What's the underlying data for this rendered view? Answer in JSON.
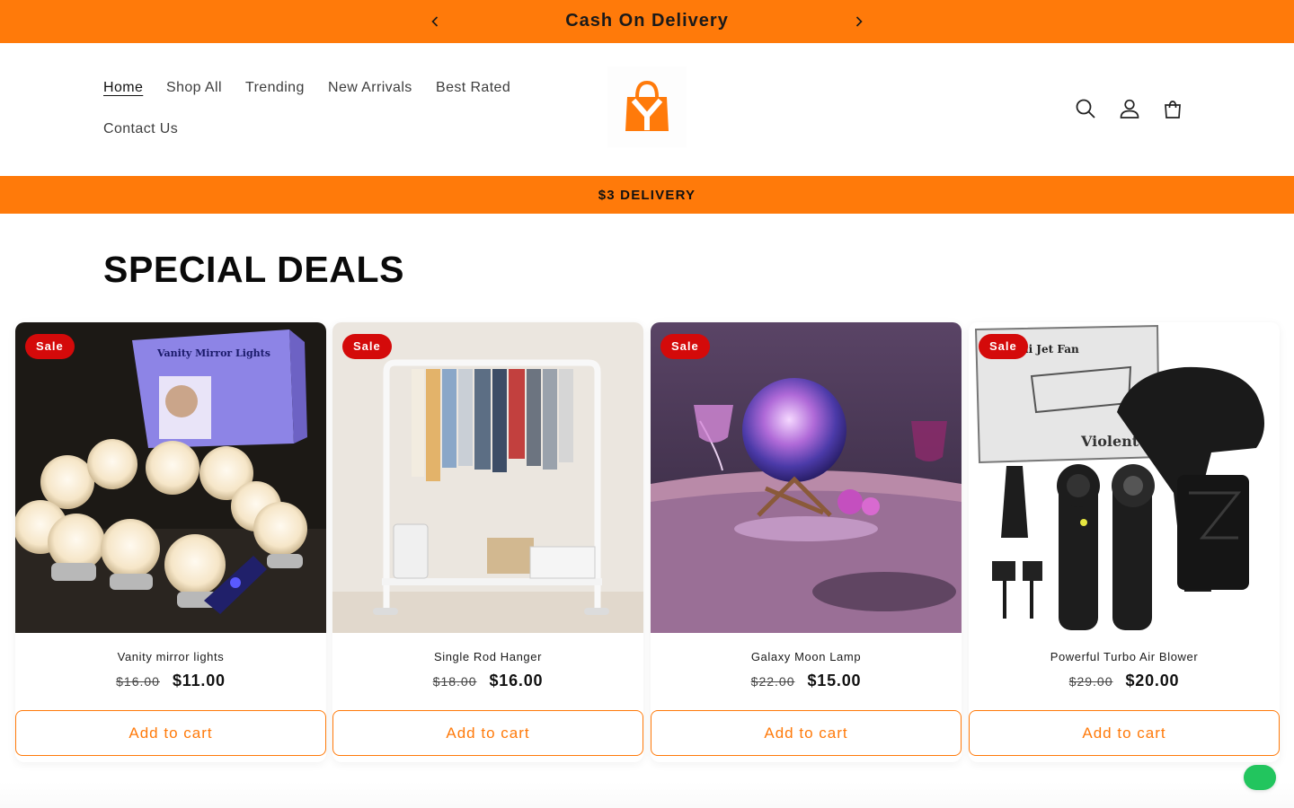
{
  "announcement": {
    "text": "Cash On Delivery",
    "prev_icon": "chevron-left-icon",
    "next_icon": "chevron-right-icon",
    "color": "#ff7a0a"
  },
  "nav": {
    "items": [
      {
        "label": "Home",
        "active": true
      },
      {
        "label": "Shop All"
      },
      {
        "label": "Trending"
      },
      {
        "label": "New Arrivals"
      },
      {
        "label": "Best Rated"
      },
      {
        "label": "Contact Us"
      }
    ]
  },
  "logo": {
    "letter": "Y",
    "icon": "shopping-bag-logo",
    "color": "#ff7a0a"
  },
  "header_icons": [
    "search-icon",
    "account-icon",
    "cart-icon"
  ],
  "delivery_banner": {
    "text": "$3 DELIVERY"
  },
  "section": {
    "title": "SPECIAL DEALS"
  },
  "products": [
    {
      "title": "Vanity mirror lights",
      "old_price": "$16.00",
      "price": "$11.00",
      "badge": "Sale",
      "button": "Add to cart"
    },
    {
      "title": "Single Rod Hanger",
      "old_price": "$18.00",
      "price": "$16.00",
      "badge": "Sale",
      "button": "Add to cart"
    },
    {
      "title": "Galaxy Moon Lamp",
      "old_price": "$22.00",
      "price": "$15.00",
      "badge": "Sale",
      "button": "Add to cart"
    },
    {
      "title": "Powerful Turbo Air Blower",
      "old_price": "$29.00",
      "price": "$20.00",
      "badge": "Sale",
      "button": "Add to cart"
    }
  ],
  "colors": {
    "accent": "#ff7a0a",
    "sale": "#d40a0a",
    "chat": "#22c55e"
  }
}
